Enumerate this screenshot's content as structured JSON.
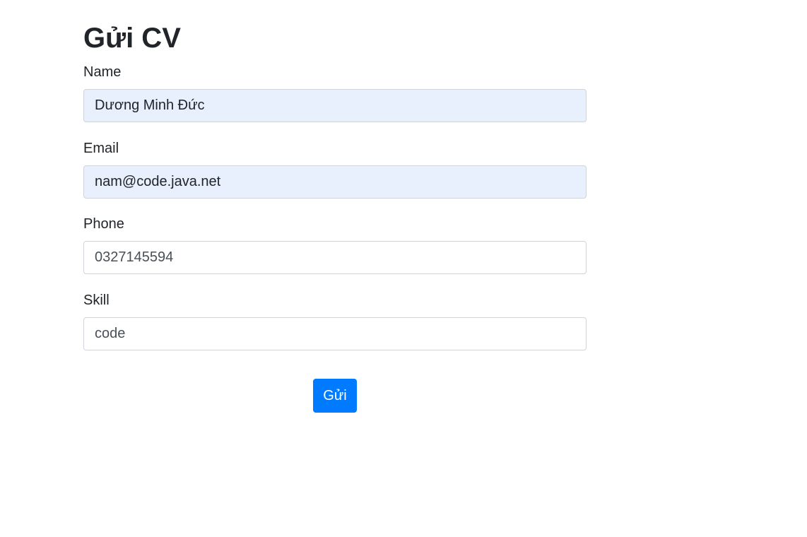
{
  "page": {
    "title": "Gửi CV"
  },
  "form": {
    "name": {
      "label": "Name",
      "value": "Dương Minh Đức"
    },
    "email": {
      "label": "Email",
      "value": "nam@code.java.net"
    },
    "phone": {
      "label": "Phone",
      "value": "0327145594"
    },
    "skill": {
      "label": "Skill",
      "value": "code"
    },
    "submit_label": "Gửi"
  },
  "colors": {
    "primary": "#007bff",
    "autofill_background": "#e8f0fe",
    "input_border": "#ced4da",
    "text": "#212529"
  }
}
